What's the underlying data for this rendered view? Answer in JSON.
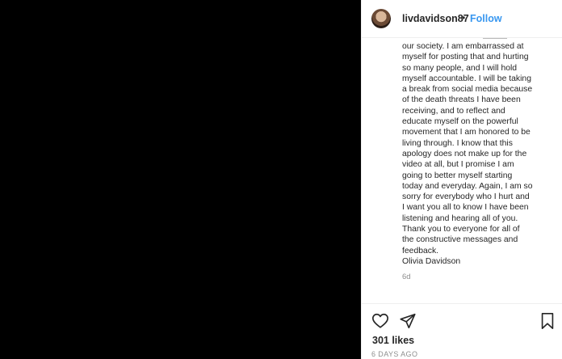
{
  "post": {
    "username": "livdavidson87",
    "separator": "•",
    "follow_label": "Follow",
    "caption_lines": [
      "our society. I am embarrassed at",
      "myself for posting that and hurting",
      "so many people, and I will hold",
      "myself accountable. I will be taking",
      "a break from social media because",
      "of the death threats I have been",
      "receiving, and to reflect and",
      "educate myself on the powerful",
      "movement that I am honored to be",
      "living through. I know that this",
      "apology does not make up for the",
      "video at all, but I promise I am",
      "going to better myself starting",
      "today and everyday. Again, I am so",
      "sorry for everybody who I hurt and",
      "I want you all to know I have been",
      "listening and hearing all of you.",
      "Thank you to everyone for all of",
      "the constructive messages and",
      "feedback.",
      "Olivia Davidson"
    ],
    "relative_time": "6d",
    "likes": "301 likes",
    "date": "6 DAYS AGO"
  },
  "icons": {
    "like": "heart-icon",
    "share": "paper-plane-icon",
    "save": "bookmark-icon"
  },
  "colors": {
    "media_background": "#000000",
    "follow": "#3897f0",
    "text": "#262626",
    "muted": "#8e8e8e"
  }
}
